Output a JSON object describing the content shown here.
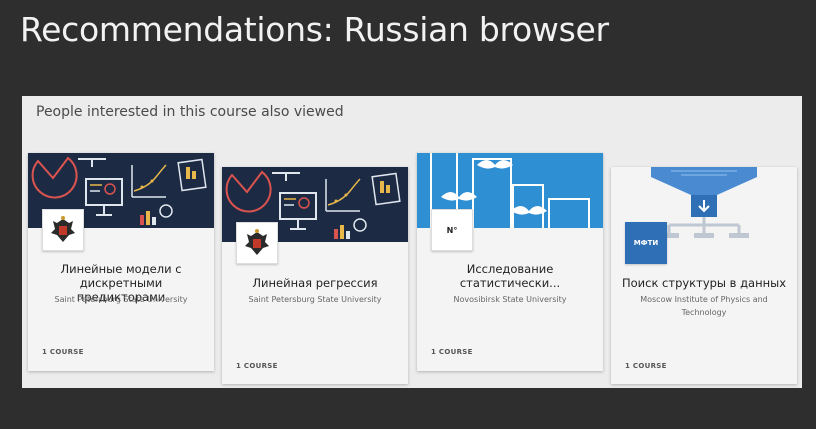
{
  "slide": {
    "title": "Recommendations: Russian browser"
  },
  "panel": {
    "heading": "People interested in this course also viewed"
  },
  "cards": [
    {
      "title_line1": "Линейные модели с",
      "title_line2": "дискретными предикторами",
      "org": "Saint Petersburg State University",
      "org_line2": "",
      "count": "1 COURSE",
      "logo": "spbu-crest-logo",
      "image": "navy-chart-illustration"
    },
    {
      "title_line1": "",
      "title_line2": "Линейная регрессия",
      "org": "Saint Petersburg State University",
      "org_line2": "",
      "count": "1 COURSE",
      "logo": "spbu-crest-logo",
      "image": "navy-chart-illustration"
    },
    {
      "title_line1": "Исследование",
      "title_line2": "статистически...",
      "org": "Novosibirsk State University",
      "org_line2": "",
      "count": "1 COURSE",
      "logo": "nsu-logo",
      "image": "blue-mustache-bars-illustration"
    },
    {
      "title_line1": "",
      "title_line2": "Поиск структуры в данных",
      "org": "Moscow Institute of Physics and",
      "org_line2": "Technology",
      "count": "1 COURSE",
      "logo": "mipt-logo",
      "image": "funnel-tree-illustration"
    }
  ],
  "logos": {
    "mipt_text": "МФТИ",
    "nsu_text": "N°"
  },
  "colors": {
    "background": "#2e2e2e",
    "panel": "#ececec",
    "navy": "#1d2a44",
    "accent_red": "#d9534f",
    "accent_yellow": "#e8b84a",
    "blue": "#2e8fd3",
    "funnel_blue": "#4a8ad0"
  }
}
